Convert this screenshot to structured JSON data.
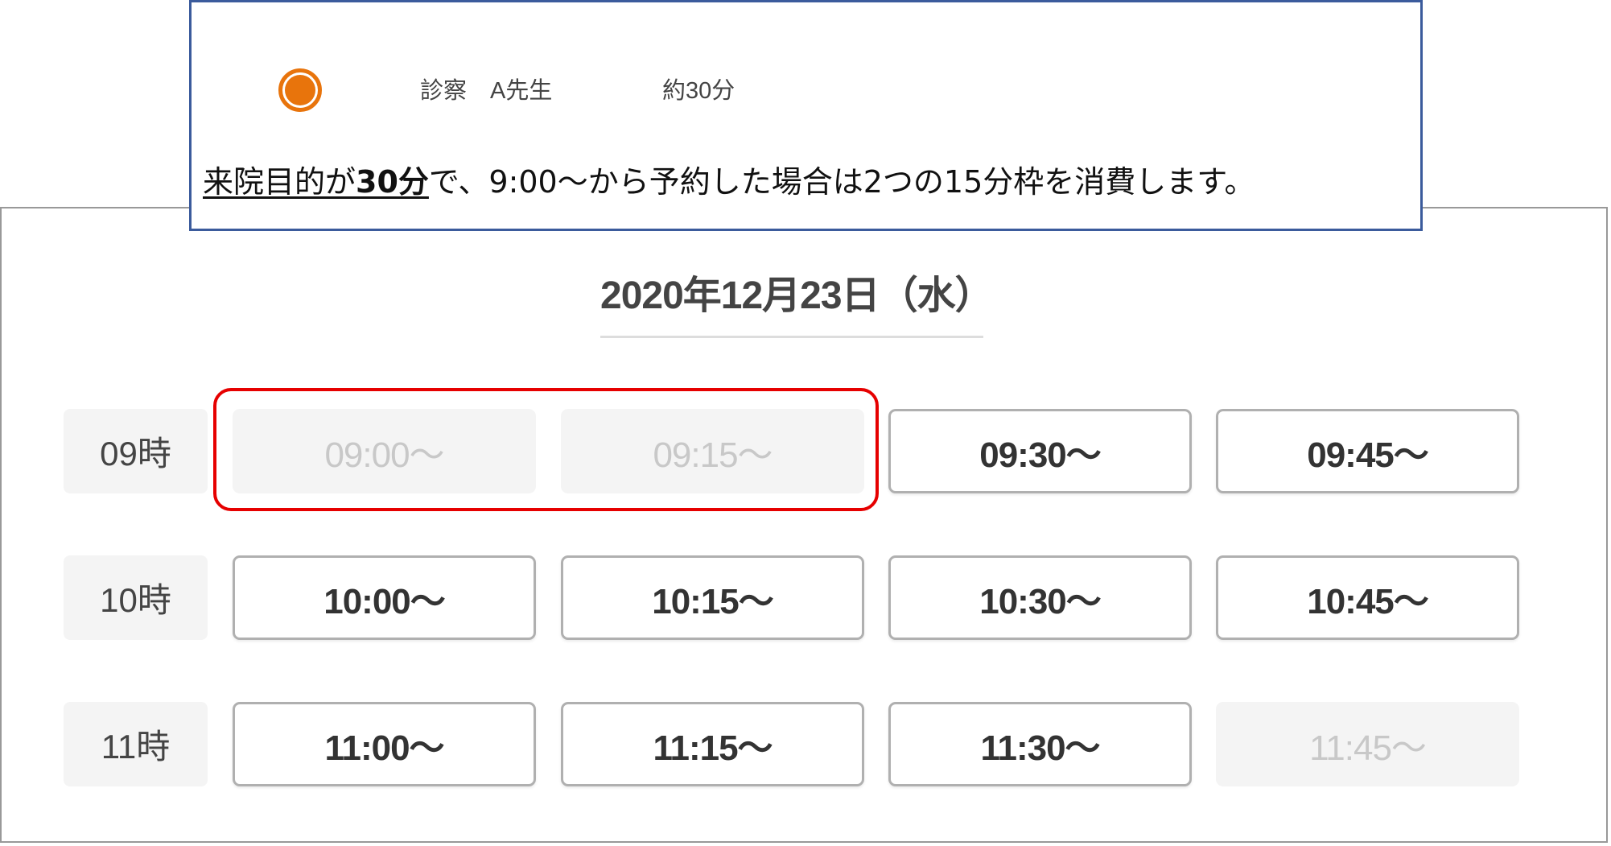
{
  "callout": {
    "menu_name": "診察　A先生",
    "menu_duration": "約30分",
    "explanation_emphasis_prefix": "来院目的が",
    "explanation_emphasis_value": "30分",
    "explanation_rest": "で、9:00～から予約した場合は2つの15分枠を消費します。",
    "radio_selected": true,
    "accent_color": "#e8740c",
    "border_color": "#3b5b9c"
  },
  "calendar": {
    "date_title": "2020年12月23日（水）",
    "rows": [
      {
        "hour_label": "09時",
        "slots": [
          {
            "label": "09:00～",
            "available": false
          },
          {
            "label": "09:15～",
            "available": false
          },
          {
            "label": "09:30～",
            "available": true
          },
          {
            "label": "09:45～",
            "available": true
          }
        ]
      },
      {
        "hour_label": "10時",
        "slots": [
          {
            "label": "10:00～",
            "available": true
          },
          {
            "label": "10:15～",
            "available": true
          },
          {
            "label": "10:30～",
            "available": true
          },
          {
            "label": "10:45～",
            "available": true
          }
        ]
      },
      {
        "hour_label": "11時",
        "slots": [
          {
            "label": "11:00～",
            "available": true
          },
          {
            "label": "11:15～",
            "available": true
          },
          {
            "label": "11:30～",
            "available": true
          },
          {
            "label": "11:45～",
            "available": false
          }
        ]
      }
    ],
    "highlight_color": "#e60000"
  }
}
